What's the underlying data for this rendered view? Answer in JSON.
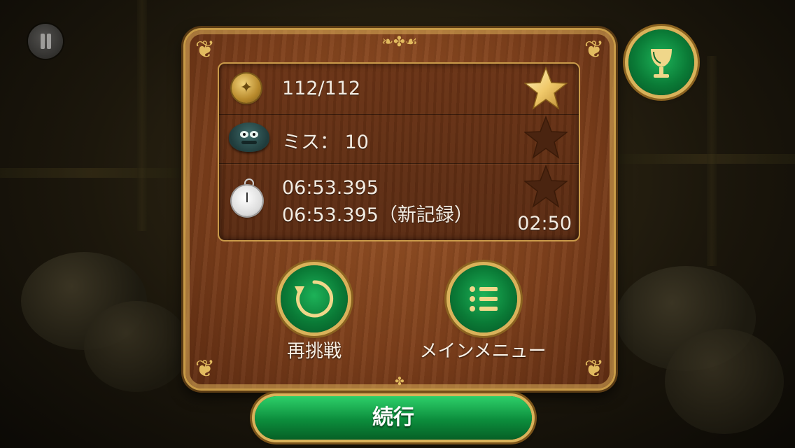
{
  "stats": {
    "coins": "112/112",
    "misses": "ミス： 10",
    "time_current": "06:53.395",
    "time_best": "06:53.395（新記録）",
    "target_time": "02:50",
    "stars_earned": 1,
    "stars_total": 3
  },
  "buttons": {
    "retry_label": "再挑戦",
    "main_menu_label": "メインメニュー",
    "continue_label": "続行"
  },
  "icons": {
    "pause": "pause-icon",
    "trophy": "trophy-icon",
    "retry": "retry-arrow-icon",
    "menu": "list-menu-icon",
    "coin": "gold-coin-icon",
    "monster": "monster-icon",
    "watch": "pocket-watch-icon",
    "star_filled": "star-filled-icon",
    "star_empty": "star-empty-icon"
  },
  "colors": {
    "panel_wood": "#7d3f1b",
    "gold_trim": "#d9b25a",
    "button_green": "#0a7a36",
    "star_gold": "#f0c96a",
    "star_empty": "#4a2410"
  }
}
